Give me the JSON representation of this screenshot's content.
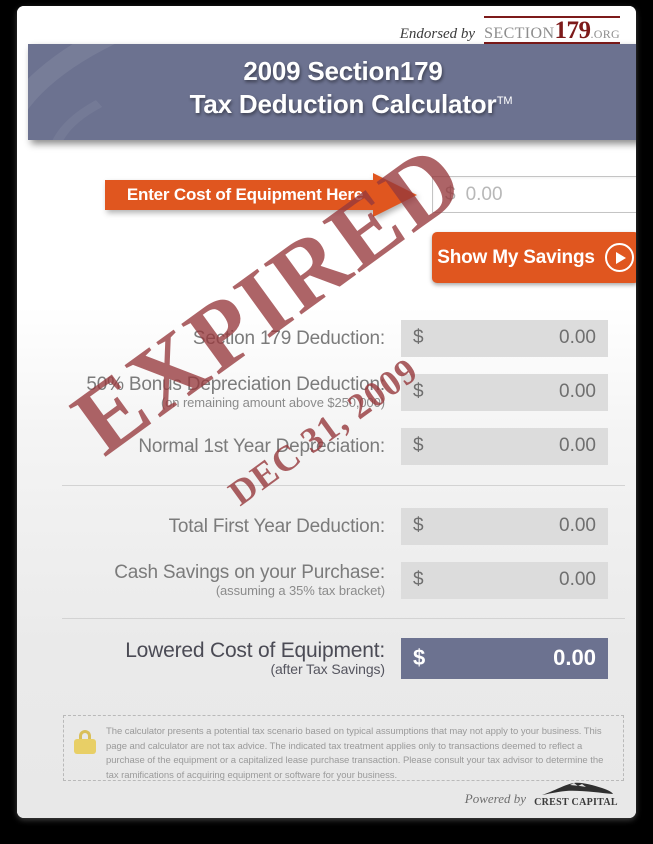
{
  "endorsement": {
    "prefix": "Endorsed by",
    "logo_section": "SECTION",
    "logo_number": "179",
    "logo_tld": ".ORG"
  },
  "banner": {
    "line1": "2009 Section179",
    "line2": "Tax Deduction Calculator",
    "trademark": "TM"
  },
  "input_section": {
    "arrow_label": "Enter Cost of Equipment Here",
    "currency_symbol": "$",
    "value": "",
    "placeholder": "0.00",
    "placeholder_display": "0.00",
    "button_label": "Show My Savings",
    "button_icon": "circle-arrow-right-icon"
  },
  "results": {
    "rows": [
      {
        "label": "Section 179 Deduction:",
        "sublabel": "",
        "currency_symbol": "$",
        "value": "0.00"
      },
      {
        "label": "50% Bonus Depreciation Deduction:",
        "sublabel": "(on remaining amount above $250,000)",
        "currency_symbol": "$",
        "value": "0.00"
      },
      {
        "label": "Normal 1st Year Depreciation:",
        "sublabel": "",
        "currency_symbol": "$",
        "value": "0.00"
      },
      {
        "label": "Total First Year Deduction:",
        "sublabel": "",
        "currency_symbol": "$",
        "value": "0.00"
      },
      {
        "label": "Cash Savings on your Purchase:",
        "sublabel": "(assuming a 35% tax bracket)",
        "currency_symbol": "$",
        "value": "0.00"
      }
    ],
    "final_row": {
      "label": "Lowered Cost of Equipment:",
      "sublabel": "(after Tax Savings)",
      "currency_symbol": "$",
      "value": "0.00"
    }
  },
  "watermark": {
    "text": "EXPIRED",
    "date": "DEC 31, 2009",
    "color": "#96383c"
  },
  "disclaimer": {
    "icon": "padlock-icon",
    "text": "The calculator presents a potential tax scenario based on typical assumptions that may not apply to your business. This page and calculator are not tax advice. The indicated tax treatment applies only to transactions deemed to reflect a purchase of the equipment or a capitalized lease purchase transaction. Please consult your tax advisor to determine the tax ramifications of acquiring equipment or software for your business."
  },
  "footer": {
    "powered_by": "Powered by",
    "brand": "CREST CAPITAL"
  },
  "theme": {
    "accent_orange": "#e0561f",
    "banner_blue": "#6c7290",
    "logo_red": "#7d1a1a",
    "value_box_gray": "#dcdcdc"
  }
}
